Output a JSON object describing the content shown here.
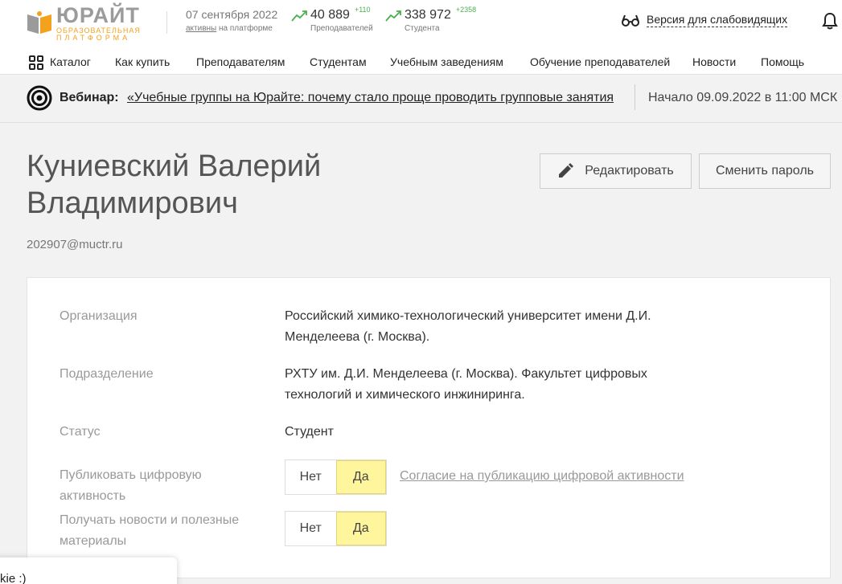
{
  "header": {
    "logo": {
      "main": "ЮРАЙТ",
      "sub1": "ОБРАЗОВАТЕЛЬНАЯ",
      "sub2": "ПЛАТФОРМА"
    },
    "date": "07 сентября 2022",
    "active_link": "активны",
    "active_suffix": "на платформе",
    "stats": [
      {
        "number": "40 889",
        "delta": "+110",
        "label": "Преподавателей"
      },
      {
        "number": "338 972",
        "delta": "+2358",
        "label": "Студента"
      }
    ],
    "accessibility_label": "Версия для слабовидящих"
  },
  "nav": {
    "items": [
      "Каталог",
      "Как купить",
      "Преподавателям",
      "Студентам",
      "Учебным заведениям",
      "Обучение преподавателей",
      "Новости",
      "Помощь"
    ]
  },
  "webinar": {
    "title": "Вебинар:",
    "link": "«Учебные группы на Юрайте: почему стало проще проводить групповые занятия",
    "date": "Начало 09.09.2022 в 11:00 МСК"
  },
  "profile": {
    "name": "Куниевский Валерий Владимирович",
    "email": "202907@muctr.ru",
    "edit_button": "Редактировать",
    "password_button": "Сменить пароль"
  },
  "details": {
    "org_label": "Организация",
    "org_value": "Российский химико-технологический университет имени Д.И. Менделеева (г. Москва).",
    "dept_label": "Подразделение",
    "dept_value": "РХТУ им. Д.И. Менделеева (г. Москва). Факультет цифровых технологий и химического инжиниринга.",
    "status_label": "Статус",
    "status_value": "Студент",
    "publish_label": "Публиковать цифровую активность",
    "publish_no": "Нет",
    "publish_yes": "Да",
    "publish_selected": "Да",
    "consent_link": "Согласие на публикацию цифровой активности",
    "news_label": "Получать новости и полезные материалы",
    "news_no": "Нет",
    "news_yes": "Да",
    "news_selected": "Да"
  },
  "cookie": {
    "text": "kie :)"
  },
  "colors": {
    "accent_yellow": "#fff59d",
    "logo_orange": "#f3a21d",
    "stat_green": "#4caf50"
  }
}
